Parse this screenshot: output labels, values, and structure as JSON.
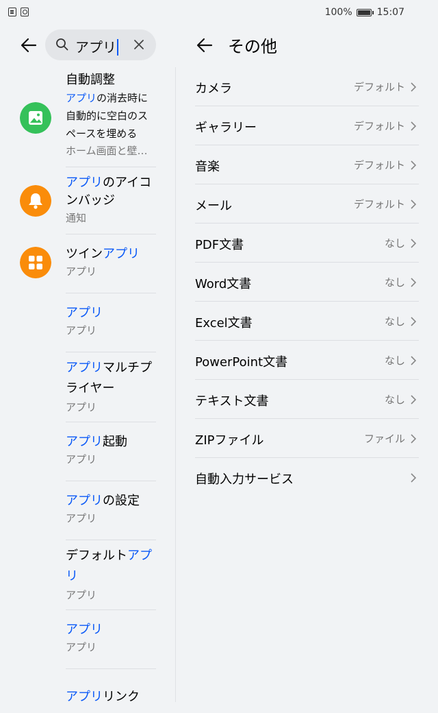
{
  "status_bar": {
    "battery": "100%",
    "time": "15:07"
  },
  "search": {
    "query": "アプリ"
  },
  "results": [
    {
      "highlight": "",
      "title_rest": "自動調整",
      "desc_hl": "アプリ",
      "desc_rest": "の消去時に自動的に空白のスペースを埋める",
      "sub": "ホーム画面と壁…",
      "icon": "image-icon",
      "icon_color": "#35c15a"
    },
    {
      "highlight": "アプリ",
      "title_rest": "のアイコンバッジ",
      "sub": "通知",
      "icon": "bell-icon",
      "icon_color": "#fa8c0a"
    },
    {
      "highlight": "",
      "pre": "ツイン",
      "title_rest": "アプリ",
      "sub": "アプリ",
      "icon": "grid-icon",
      "icon_color": "#fa8c0a"
    },
    {
      "highlight": "アプリ",
      "title_rest": "",
      "sub": "アプリ"
    },
    {
      "highlight": "アプリ",
      "title_rest": "マルチプライヤー",
      "sub": "アプリ"
    },
    {
      "highlight": "アプリ",
      "title_rest": "起動",
      "sub": "アプリ"
    },
    {
      "highlight": "アプリ",
      "title_rest": "の設定",
      "sub": "アプリ"
    },
    {
      "highlight": "",
      "pre": "デフォルト",
      "title_rest": "アプリ",
      "sub": "アプリ"
    },
    {
      "highlight": "アプリ",
      "title_rest": "",
      "sub": "アプリ"
    },
    {
      "highlight": "アプリ",
      "title_rest": "リンク",
      "sub": ""
    }
  ],
  "right_pane": {
    "title": "その他",
    "items": [
      {
        "label": "カメラ",
        "value": "デフォルト"
      },
      {
        "label": "ギャラリー",
        "value": "デフォルト"
      },
      {
        "label": "音楽",
        "value": "デフォルト"
      },
      {
        "label": "メール",
        "value": "デフォルト"
      },
      {
        "label": "PDF文書",
        "value": "なし"
      },
      {
        "label": "Word文書",
        "value": "なし"
      },
      {
        "label": "Excel文書",
        "value": "なし"
      },
      {
        "label": "PowerPoint文書",
        "value": "なし"
      },
      {
        "label": "テキスト文書",
        "value": "なし"
      },
      {
        "label": "ZIPファイル",
        "value": "ファイル"
      },
      {
        "label": "自動入力サービス",
        "value": ""
      }
    ]
  },
  "colors": {
    "accent": "#0a59f7",
    "green": "#35c15a",
    "orange": "#fa8c0a"
  }
}
